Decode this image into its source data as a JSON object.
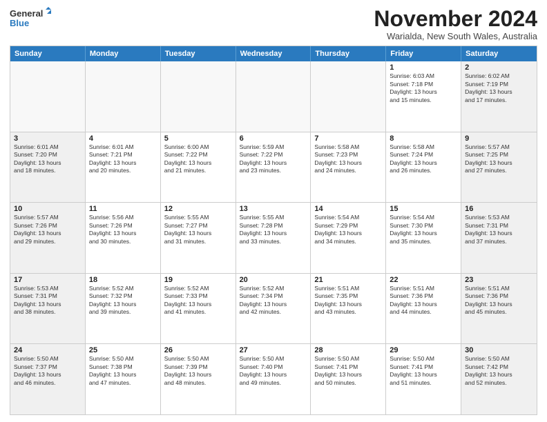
{
  "logo": {
    "line1": "General",
    "line2": "Blue"
  },
  "title": "November 2024",
  "subtitle": "Warialda, New South Wales, Australia",
  "headers": [
    "Sunday",
    "Monday",
    "Tuesday",
    "Wednesday",
    "Thursday",
    "Friday",
    "Saturday"
  ],
  "rows": [
    [
      {
        "day": "",
        "info": ""
      },
      {
        "day": "",
        "info": ""
      },
      {
        "day": "",
        "info": ""
      },
      {
        "day": "",
        "info": ""
      },
      {
        "day": "",
        "info": ""
      },
      {
        "day": "1",
        "info": "Sunrise: 6:03 AM\nSunset: 7:18 PM\nDaylight: 13 hours\nand 15 minutes."
      },
      {
        "day": "2",
        "info": "Sunrise: 6:02 AM\nSunset: 7:19 PM\nDaylight: 13 hours\nand 17 minutes."
      }
    ],
    [
      {
        "day": "3",
        "info": "Sunrise: 6:01 AM\nSunset: 7:20 PM\nDaylight: 13 hours\nand 18 minutes."
      },
      {
        "day": "4",
        "info": "Sunrise: 6:01 AM\nSunset: 7:21 PM\nDaylight: 13 hours\nand 20 minutes."
      },
      {
        "day": "5",
        "info": "Sunrise: 6:00 AM\nSunset: 7:22 PM\nDaylight: 13 hours\nand 21 minutes."
      },
      {
        "day": "6",
        "info": "Sunrise: 5:59 AM\nSunset: 7:22 PM\nDaylight: 13 hours\nand 23 minutes."
      },
      {
        "day": "7",
        "info": "Sunrise: 5:58 AM\nSunset: 7:23 PM\nDaylight: 13 hours\nand 24 minutes."
      },
      {
        "day": "8",
        "info": "Sunrise: 5:58 AM\nSunset: 7:24 PM\nDaylight: 13 hours\nand 26 minutes."
      },
      {
        "day": "9",
        "info": "Sunrise: 5:57 AM\nSunset: 7:25 PM\nDaylight: 13 hours\nand 27 minutes."
      }
    ],
    [
      {
        "day": "10",
        "info": "Sunrise: 5:57 AM\nSunset: 7:26 PM\nDaylight: 13 hours\nand 29 minutes."
      },
      {
        "day": "11",
        "info": "Sunrise: 5:56 AM\nSunset: 7:26 PM\nDaylight: 13 hours\nand 30 minutes."
      },
      {
        "day": "12",
        "info": "Sunrise: 5:55 AM\nSunset: 7:27 PM\nDaylight: 13 hours\nand 31 minutes."
      },
      {
        "day": "13",
        "info": "Sunrise: 5:55 AM\nSunset: 7:28 PM\nDaylight: 13 hours\nand 33 minutes."
      },
      {
        "day": "14",
        "info": "Sunrise: 5:54 AM\nSunset: 7:29 PM\nDaylight: 13 hours\nand 34 minutes."
      },
      {
        "day": "15",
        "info": "Sunrise: 5:54 AM\nSunset: 7:30 PM\nDaylight: 13 hours\nand 35 minutes."
      },
      {
        "day": "16",
        "info": "Sunrise: 5:53 AM\nSunset: 7:31 PM\nDaylight: 13 hours\nand 37 minutes."
      }
    ],
    [
      {
        "day": "17",
        "info": "Sunrise: 5:53 AM\nSunset: 7:31 PM\nDaylight: 13 hours\nand 38 minutes."
      },
      {
        "day": "18",
        "info": "Sunrise: 5:52 AM\nSunset: 7:32 PM\nDaylight: 13 hours\nand 39 minutes."
      },
      {
        "day": "19",
        "info": "Sunrise: 5:52 AM\nSunset: 7:33 PM\nDaylight: 13 hours\nand 41 minutes."
      },
      {
        "day": "20",
        "info": "Sunrise: 5:52 AM\nSunset: 7:34 PM\nDaylight: 13 hours\nand 42 minutes."
      },
      {
        "day": "21",
        "info": "Sunrise: 5:51 AM\nSunset: 7:35 PM\nDaylight: 13 hours\nand 43 minutes."
      },
      {
        "day": "22",
        "info": "Sunrise: 5:51 AM\nSunset: 7:36 PM\nDaylight: 13 hours\nand 44 minutes."
      },
      {
        "day": "23",
        "info": "Sunrise: 5:51 AM\nSunset: 7:36 PM\nDaylight: 13 hours\nand 45 minutes."
      }
    ],
    [
      {
        "day": "24",
        "info": "Sunrise: 5:50 AM\nSunset: 7:37 PM\nDaylight: 13 hours\nand 46 minutes."
      },
      {
        "day": "25",
        "info": "Sunrise: 5:50 AM\nSunset: 7:38 PM\nDaylight: 13 hours\nand 47 minutes."
      },
      {
        "day": "26",
        "info": "Sunrise: 5:50 AM\nSunset: 7:39 PM\nDaylight: 13 hours\nand 48 minutes."
      },
      {
        "day": "27",
        "info": "Sunrise: 5:50 AM\nSunset: 7:40 PM\nDaylight: 13 hours\nand 49 minutes."
      },
      {
        "day": "28",
        "info": "Sunrise: 5:50 AM\nSunset: 7:41 PM\nDaylight: 13 hours\nand 50 minutes."
      },
      {
        "day": "29",
        "info": "Sunrise: 5:50 AM\nSunset: 7:41 PM\nDaylight: 13 hours\nand 51 minutes."
      },
      {
        "day": "30",
        "info": "Sunrise: 5:50 AM\nSunset: 7:42 PM\nDaylight: 13 hours\nand 52 minutes."
      }
    ]
  ]
}
